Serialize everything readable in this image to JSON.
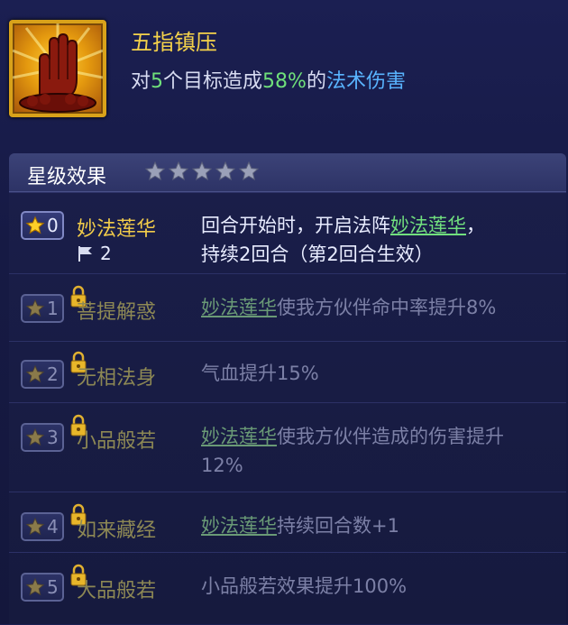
{
  "skill": {
    "name": "五指镇压",
    "desc_prefix": "对",
    "target_count": "5",
    "desc_middle": "个目标造成",
    "damage_pct": "58%",
    "desc_link": "的",
    "damage_type": "法术伤害",
    "icon": "palm-seal-icon"
  },
  "star_panel": {
    "title": "星级效果",
    "stars_total": 5,
    "stars_filled": 0
  },
  "star_effects": [
    {
      "level": "0",
      "name": "妙法莲华",
      "flag_count": "2",
      "unlocked": true,
      "desc_pre": "回合开始时，开启法阵",
      "desc_link": "妙法莲华",
      "desc_post": "，",
      "desc_line2": "持续2回合（第2回合生效）"
    },
    {
      "level": "1",
      "name": "菩提解惑",
      "unlocked": false,
      "desc_pre": "",
      "desc_link": "妙法莲华",
      "desc_post": "使我方伙伴命中率提升8%"
    },
    {
      "level": "2",
      "name": "无相法身",
      "unlocked": false,
      "desc_pre": "气血提升15%",
      "desc_link": "",
      "desc_post": ""
    },
    {
      "level": "3",
      "name": "小品般若",
      "unlocked": false,
      "desc_pre": "",
      "desc_link": "妙法莲华",
      "desc_post": "使我方伙伴造成的伤害提升12%"
    },
    {
      "level": "4",
      "name": "如来藏经",
      "unlocked": false,
      "desc_pre": "",
      "desc_link": "妙法莲华",
      "desc_post": "持续回合数+1"
    },
    {
      "level": "5",
      "name": "大品般若",
      "unlocked": false,
      "desc_pre": "小品般若效果提升100%",
      "desc_link": "",
      "desc_post": ""
    }
  ],
  "colors": {
    "accent_gold": "#f2cc4a",
    "number_green": "#6fe07a",
    "link_blue": "#59b4ff"
  }
}
